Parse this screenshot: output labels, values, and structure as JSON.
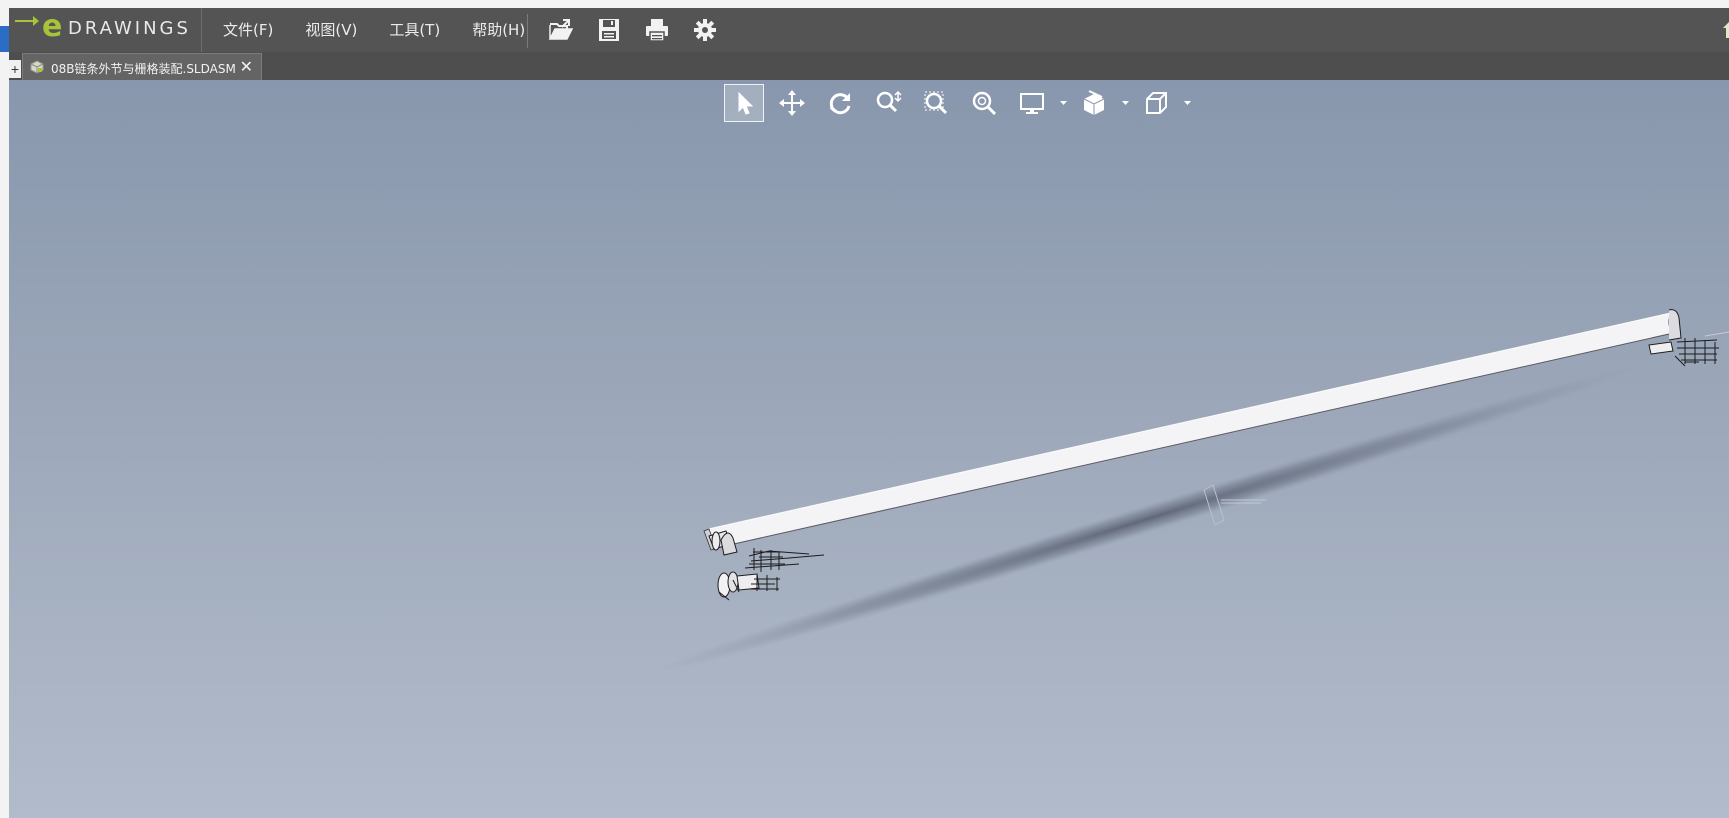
{
  "app": {
    "logo_text": "DRAWINGS",
    "logo_letter": "e"
  },
  "menu": {
    "items": [
      {
        "id": "file",
        "label": "文件(F)"
      },
      {
        "id": "view",
        "label": "视图(V)"
      },
      {
        "id": "tools",
        "label": "工具(T)"
      },
      {
        "id": "help",
        "label": "帮助(H)"
      }
    ]
  },
  "main_toolbar": {
    "icons": [
      "open-icon",
      "save-icon",
      "print-icon",
      "settings-icon"
    ]
  },
  "tabs": {
    "plus_label": "+",
    "document_title": "08B链条外节与栅格装配.SLDASM",
    "close_label": "✕"
  },
  "view_toolbar": {
    "tools": [
      "select-icon",
      "pan-icon",
      "rotate-icon",
      "zoom-icon",
      "zoom-to-area-icon",
      "zoom-to-fit-icon",
      "display-style-icon",
      "section-icon",
      "standard-views-icon"
    ],
    "active_tool": "select-icon"
  },
  "colors": {
    "menubar": "#545454",
    "accent_green": "#a6c33a",
    "viewport_top": "#8897ad",
    "viewport_bottom": "#b2bbcb"
  }
}
